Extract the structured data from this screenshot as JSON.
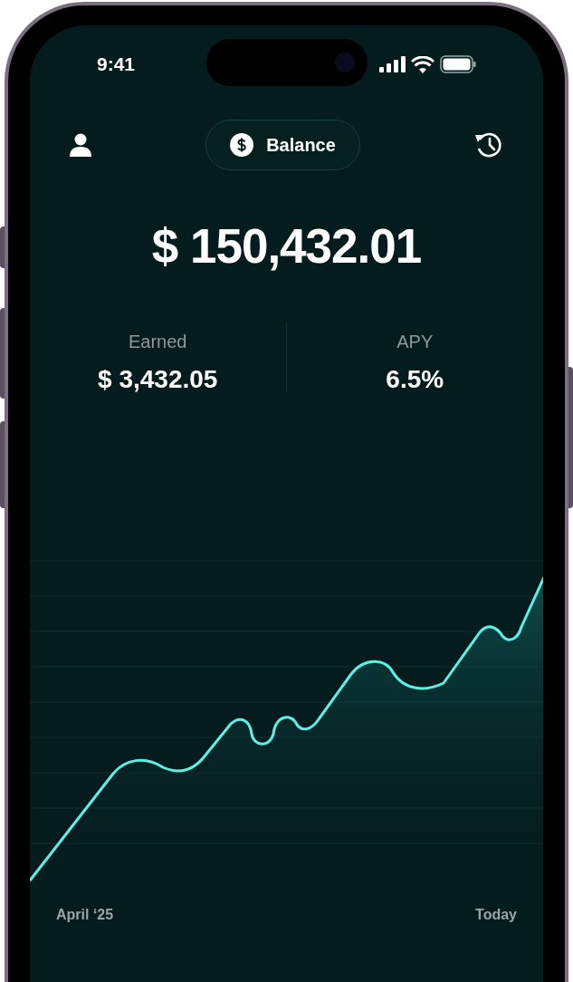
{
  "status_bar": {
    "time": "9:41"
  },
  "header": {
    "title": "Balance"
  },
  "balance": "$ 150,432.01",
  "stats": [
    {
      "label": "Earned",
      "value": "$ 3,432.05"
    },
    {
      "label": "APY",
      "value": "6.5%"
    }
  ],
  "chart": {
    "start_label": "April ‘25",
    "end_label": "Today"
  }
}
